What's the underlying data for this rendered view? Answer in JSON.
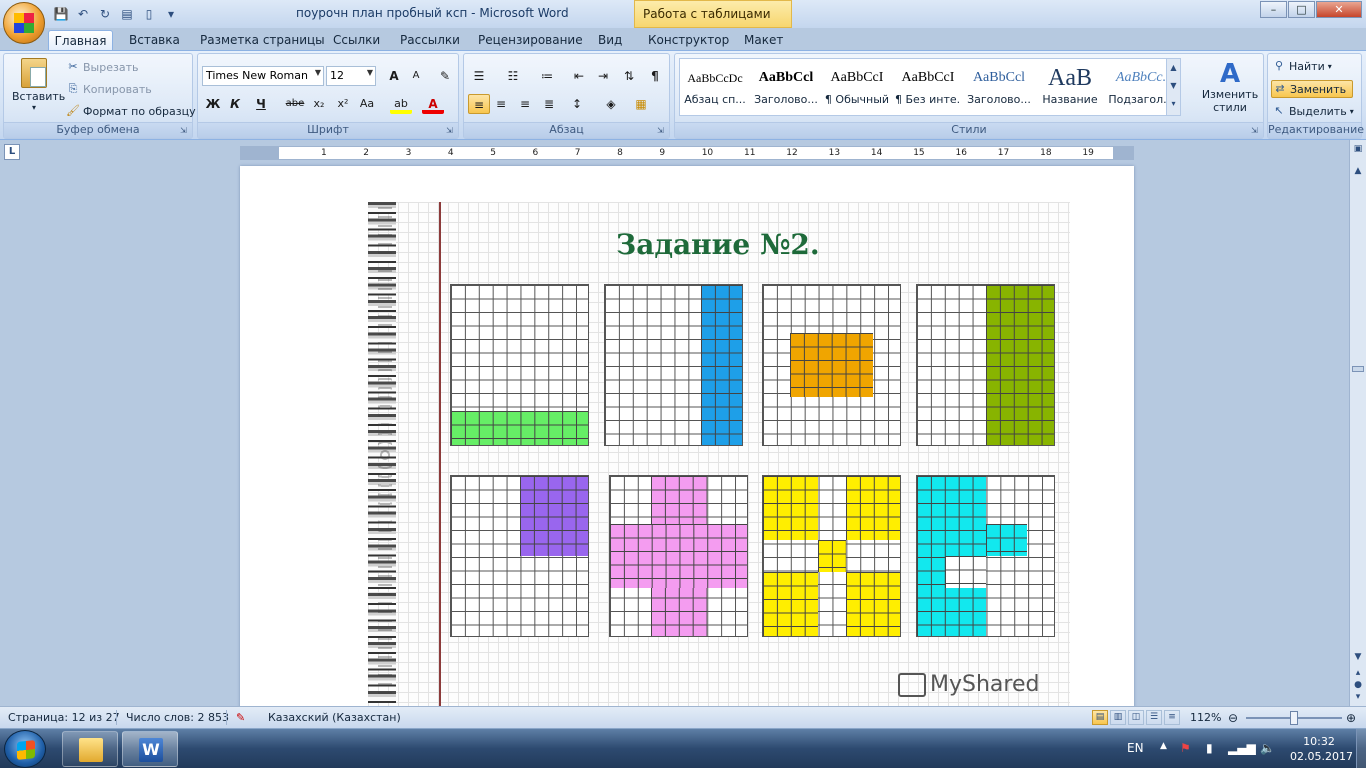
{
  "window": {
    "doc_title": "поурочн план пробный ксп - Microsoft Word",
    "context_tab_title": "Работа с таблицами",
    "minimize": "–",
    "maximize": "□",
    "close": "✕"
  },
  "tabs": [
    {
      "label": "Главная",
      "active": true
    },
    {
      "label": "Вставка"
    },
    {
      "label": "Разметка страницы"
    },
    {
      "label": "Ссылки"
    },
    {
      "label": "Рассылки"
    },
    {
      "label": "Рецензирование"
    },
    {
      "label": "Вид"
    },
    {
      "label": "Конструктор"
    },
    {
      "label": "Макет"
    }
  ],
  "clipboard": {
    "label": "Буфер обмена",
    "paste": "Вставить",
    "cut": "Вырезать",
    "copy": "Копировать",
    "format_painter": "Формат по образцу"
  },
  "font": {
    "label": "Шрифт",
    "font_name": "Times New Roman",
    "font_size": "12",
    "grow": "A",
    "shrink": "A",
    "bold": "Ж",
    "italic": "К",
    "underline": "Ч",
    "strike": "abe",
    "subscript": "x₂",
    "superscript": "x²",
    "case": "Aa",
    "highlight": "ab",
    "font_color": "A"
  },
  "paragraph": {
    "label": "Абзац",
    "pilcrow": "¶"
  },
  "styles": {
    "label": "Стили",
    "items": [
      {
        "sample": "AaBbCcDc",
        "name": "Абзац сп..."
      },
      {
        "sample": "AaBbCcl",
        "name": "Заголово..."
      },
      {
        "sample": "AaBbCcI",
        "name": "¶ Обычный"
      },
      {
        "sample": "AaBbCcI",
        "name": "¶ Без инте..."
      },
      {
        "sample": "AaBbCcl",
        "name": "Заголово..."
      },
      {
        "sample": "AaB",
        "name": "Название"
      },
      {
        "sample": "AaBbCc.",
        "name": "Подзагол..."
      }
    ],
    "change_styles": "Изменить стили"
  },
  "editing": {
    "label": "Редактирование",
    "find": "Найти",
    "replace": "Заменить",
    "select": "Выделить"
  },
  "ruler": {
    "corner": "L",
    "numbers": [
      "1",
      "2",
      "3",
      "4",
      "5",
      "6",
      "7",
      "8",
      "9",
      "10",
      "11",
      "12",
      "13",
      "14",
      "15",
      "16",
      "17",
      "18",
      "19"
    ]
  },
  "slide": {
    "title": "Задание №2.",
    "watermark": "MyShared"
  },
  "status": {
    "page": "Страница: 12 из 27",
    "words": "Число слов: 2 853",
    "language": "Казахский (Казахстан)",
    "zoom": "112%",
    "zoom_level_percent": 112
  },
  "taskbar": {
    "lang": "EN",
    "time": "10:32",
    "date": "02.05.2017"
  },
  "colors": {
    "green": "#66ee66",
    "blue": "#1e9fe8",
    "orange": "#f0a500",
    "olive": "#88b400",
    "purple": "#9966ee",
    "pink": "#f49cf0",
    "yellow": "#ffee00",
    "cyan": "#12e8ee",
    "title_green": "#1e6a3a"
  }
}
